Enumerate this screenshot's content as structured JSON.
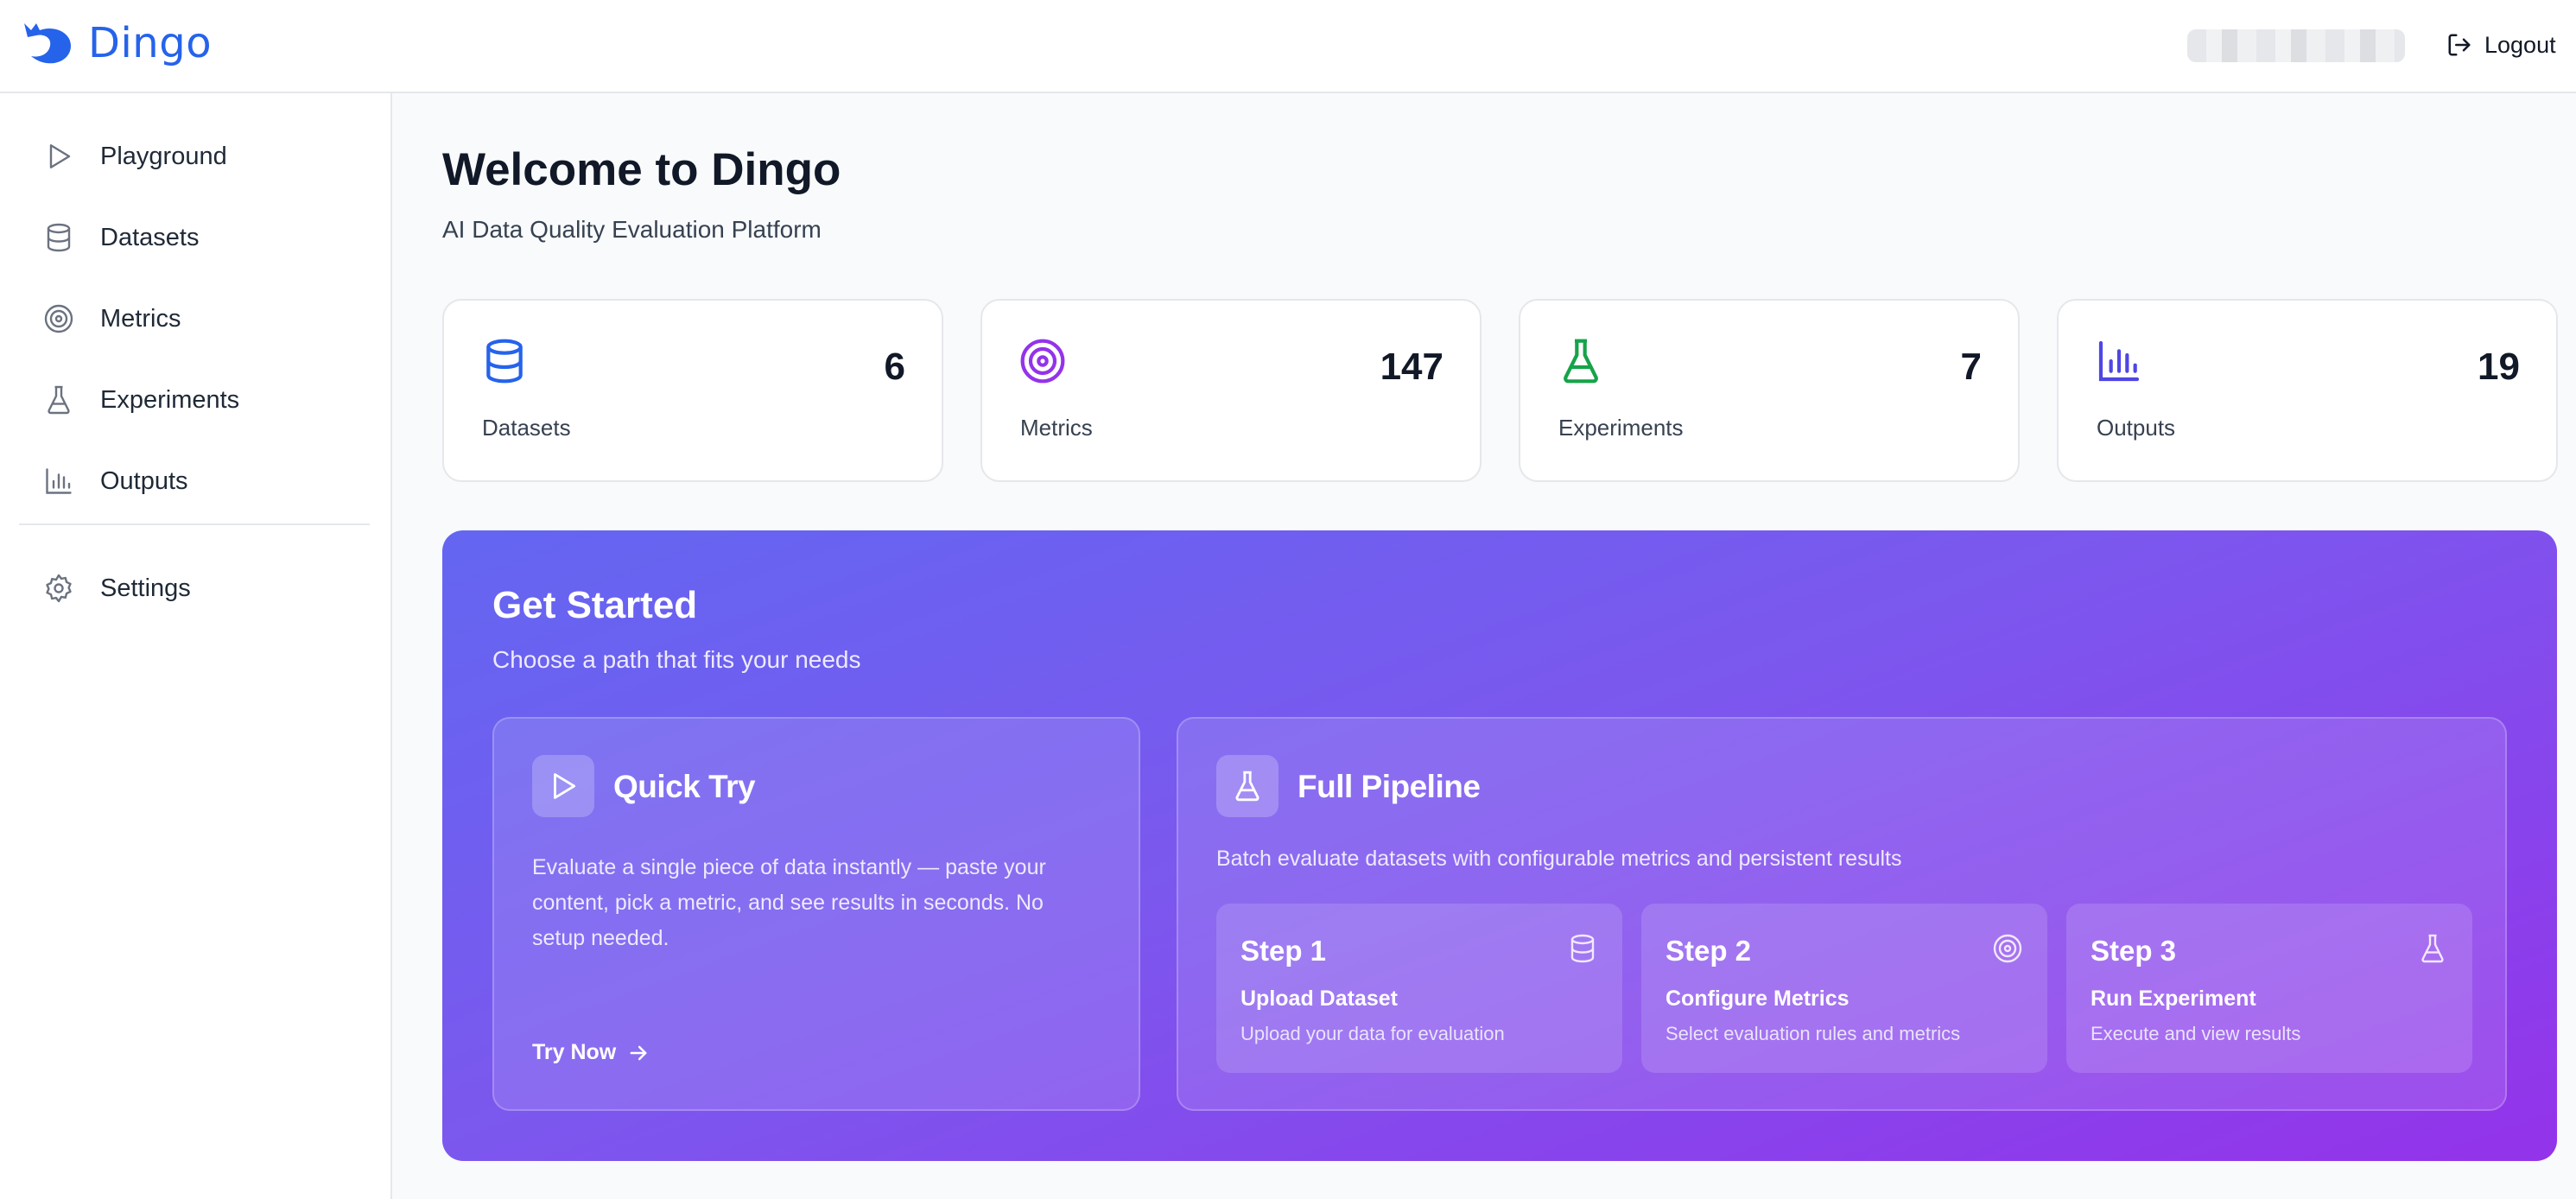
{
  "app": {
    "name": "Dingo"
  },
  "header": {
    "logout_label": "Logout"
  },
  "sidebar": {
    "items": [
      {
        "label": "Playground",
        "icon": "play-icon"
      },
      {
        "label": "Datasets",
        "icon": "database-icon"
      },
      {
        "label": "Metrics",
        "icon": "target-icon"
      },
      {
        "label": "Experiments",
        "icon": "flask-icon"
      },
      {
        "label": "Outputs",
        "icon": "bar-chart-icon"
      },
      {
        "label": "Settings",
        "icon": "gear-icon"
      }
    ]
  },
  "main": {
    "title": "Welcome to Dingo",
    "subtitle": "AI Data Quality Evaluation Platform",
    "stats": [
      {
        "label": "Datasets",
        "value": "6",
        "icon": "database-icon",
        "color": "#2563eb"
      },
      {
        "label": "Metrics",
        "value": "147",
        "icon": "target-icon",
        "color": "#9333ea"
      },
      {
        "label": "Experiments",
        "value": "7",
        "icon": "flask-icon",
        "color": "#16a34a"
      },
      {
        "label": "Outputs",
        "value": "19",
        "icon": "bar-chart-icon",
        "color": "#4f46e5"
      }
    ]
  },
  "get_started": {
    "title": "Get Started",
    "subtitle": "Choose a path that fits your needs",
    "quick_try": {
      "title": "Quick Try",
      "description": "Evaluate a single piece of data instantly — paste your content, pick a metric, and see results in seconds. No setup needed.",
      "cta": "Try Now"
    },
    "full_pipeline": {
      "title": "Full Pipeline",
      "description": "Batch evaluate datasets with configurable metrics and persistent results",
      "steps": [
        {
          "title": "Step 1",
          "name": "Upload Dataset",
          "description": "Upload your data for evaluation",
          "icon": "database-icon"
        },
        {
          "title": "Step 2",
          "name": "Configure Metrics",
          "description": "Select evaluation rules and metrics",
          "icon": "target-icon"
        },
        {
          "title": "Step 3",
          "name": "Run Experiment",
          "description": "Execute and view results",
          "icon": "flask-icon"
        }
      ]
    }
  }
}
